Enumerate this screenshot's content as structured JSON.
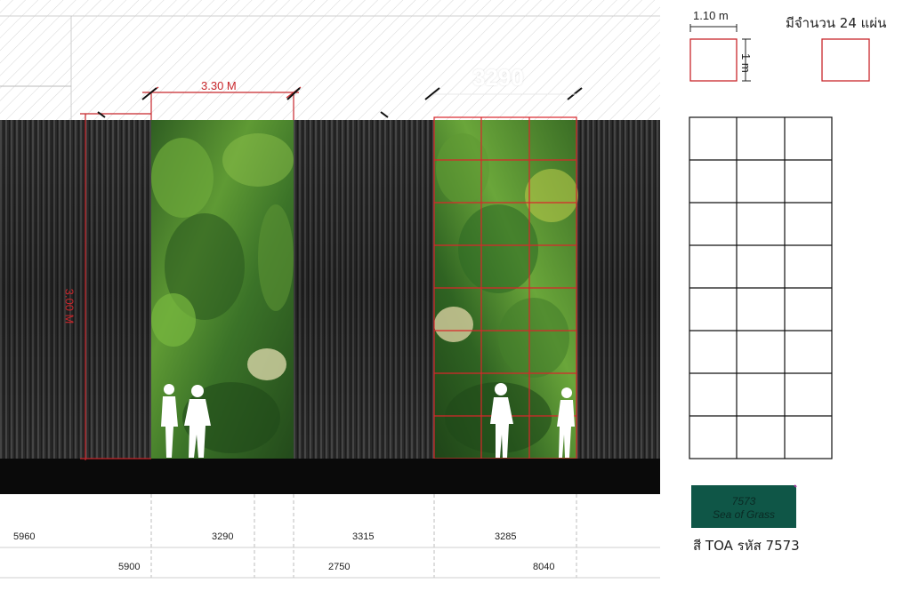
{
  "elevation": {
    "wall_width_label": "3.30 M",
    "wall_height_label": "3.00 M",
    "ghost_label": "3290",
    "bottom_dimensions_row1": [
      "5960",
      "3290",
      "3315",
      "3285"
    ],
    "bottom_dimensions_row2": [
      "5900",
      "2750",
      "8040"
    ]
  },
  "legend": {
    "panel_width_label": "1.10 m",
    "panel_height_label": "1 m",
    "panel_count_label": "มีจำนวน 24 แผ่น",
    "grid_columns": 3,
    "grid_rows": 8
  },
  "color_sample": {
    "code": "7573",
    "name": "Sea of Grass",
    "swatch_color": "#0f5647",
    "caption": "สี TOA รหัส 7573"
  },
  "colors": {
    "dimension_red": "#c8262b",
    "foliage_green": "#3f7a2c",
    "cladding_gray": "#2b2b2b"
  }
}
